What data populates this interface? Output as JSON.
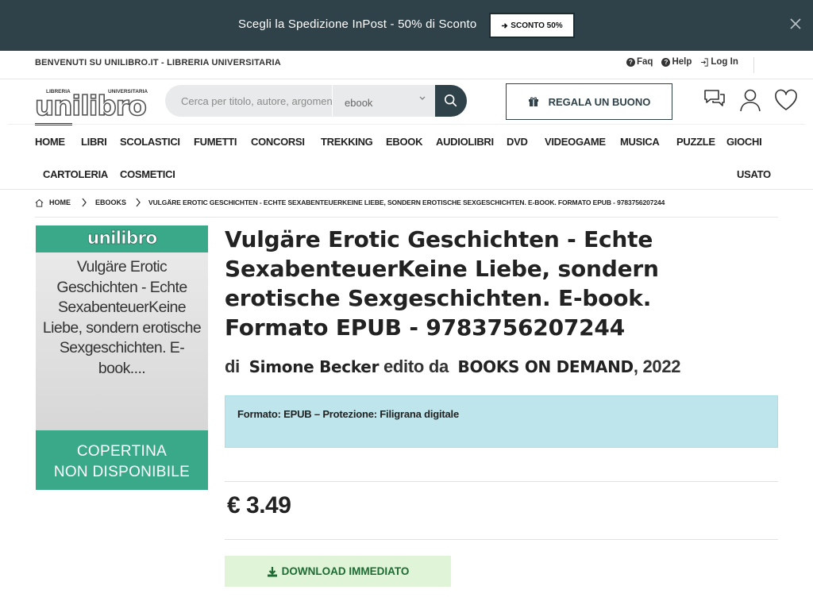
{
  "promo": {
    "text": "Scegli la Spedizione InPost - 50% di Sconto",
    "button_label": "SCONTO 50%"
  },
  "topbar": {
    "welcome": "BENVENUTI SU UNILIBRO.IT - LIBRERIA UNIVERSITARIA",
    "faq": "Faq",
    "help": "Help",
    "login": "Log In"
  },
  "logo": {
    "top_left": "LIBRERIA",
    "top_right": "UNIVERSITARIA",
    "main": "unilibro"
  },
  "search": {
    "placeholder": "Cerca per titolo, autore, argomento",
    "category": "ebook"
  },
  "header": {
    "gift_label": "REGALA UN BUONO"
  },
  "nav": {
    "row1": [
      "HOME",
      "LIBRI",
      "SCOLASTICI",
      "FUMETTI",
      "CONCORSI",
      "TREKKING",
      "EBOOK",
      "AUDIOLIBRI",
      "DVD",
      "VIDEOGAME",
      "MUSICA",
      "PUZZLE",
      "GIOCHI"
    ],
    "row2": [
      "CARTOLERIA",
      "COSMETICI",
      "USATO"
    ]
  },
  "breadcrumb": {
    "home": "HOME",
    "section": "EBOOKS",
    "current": "VULGÄRE EROTIC GESCHICHTEN - ECHTE SEXABENTEUERKEINE LIEBE, SONDERN EROTISCHE SEXGESCHICHTEN. E-BOOK. FORMATO EPUB - 9783756207244"
  },
  "cover": {
    "logo": "unilibro",
    "title": "Vulgäre Erotic Geschichten - Echte SexabenteuerKeine Liebe, sondern erotische Sexgeschichten. E-book....",
    "not_available_1": "COPERTINA",
    "not_available_2": "NON DISPONIBILE"
  },
  "product": {
    "title": "Vulgäre Erotic Geschichten - Echte SexabenteuerKeine Liebe, sondern erotische Sexgeschichten. E-book. Formato EPUB - 9783756207244",
    "by_prefix": "di",
    "author": "Simone Becker",
    "edited_by": "edito da",
    "publisher": "BOOKS ON DEMAND",
    "year": ", 2022",
    "format_info": "Formato: EPUB – Protezione: Filigrana digitale",
    "price": "€ 3.49",
    "download_label": "DOWNLOAD IMMEDIATO"
  },
  "colors": {
    "dark_teal": "#2f4149",
    "cover_green": "#3aa98a",
    "info_box": "#bee5eb",
    "download_bg": "#e0f5d8",
    "download_text": "#1d6b33"
  }
}
